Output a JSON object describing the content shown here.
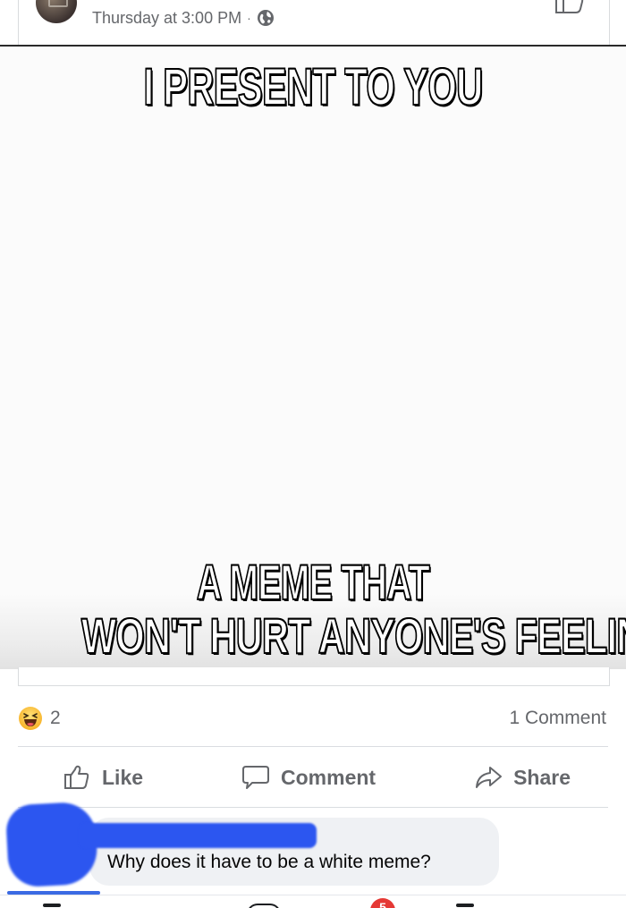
{
  "post": {
    "timestamp": "Thursday at 3:00 PM",
    "separator": "·",
    "privacy_icon": "globe-icon"
  },
  "meme": {
    "top_text": "I PRESENT TO YOU",
    "bottom_line1": "A MEME THAT",
    "bottom_line2": "WON'T HURT ANYONE'S FEELING"
  },
  "reactions": {
    "icon": "haha-icon",
    "count": "2",
    "comments": "1 Comment"
  },
  "actions": {
    "like": "Like",
    "comment": "Comment",
    "share": "Share"
  },
  "comment": {
    "text": "Why does it have to be a white meme?"
  },
  "nav": {
    "badge": "5"
  },
  "colors": {
    "redaction": "#2c56f0",
    "muted_text": "#65676b",
    "bubble": "#eff1f4"
  }
}
